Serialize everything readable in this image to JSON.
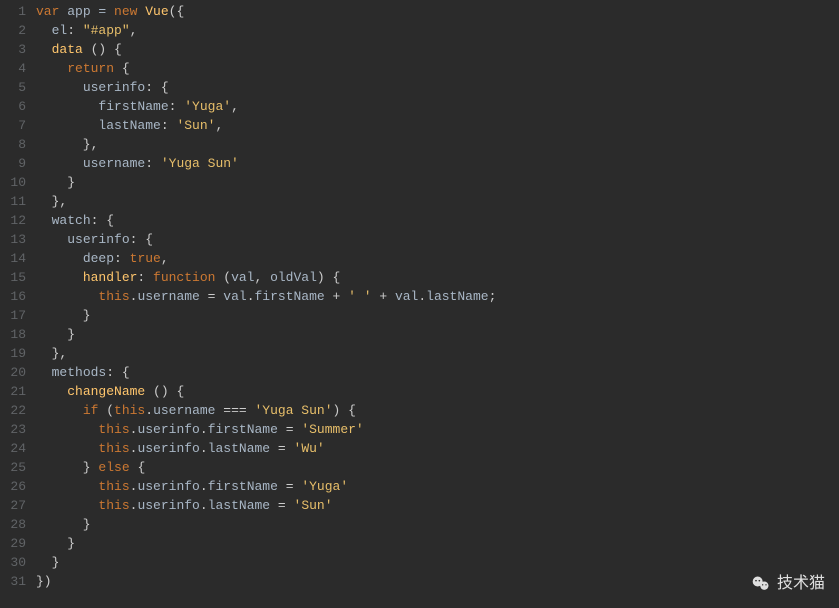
{
  "lineCount": 31,
  "watermark": "技术猫",
  "code": {
    "lines": [
      [
        {
          "t": "var ",
          "c": "kw"
        },
        {
          "t": "app = ",
          "c": "ident"
        },
        {
          "t": "new ",
          "c": "kw"
        },
        {
          "t": "Vue",
          "c": "fn"
        },
        {
          "t": "({",
          "c": "punc"
        }
      ],
      [
        {
          "t": "  ",
          "c": "plain"
        },
        {
          "t": "el",
          "c": "prop"
        },
        {
          "t": ": ",
          "c": "punc"
        },
        {
          "t": "\"#app\"",
          "c": "strq"
        },
        {
          "t": ",",
          "c": "punc"
        }
      ],
      [
        {
          "t": "  ",
          "c": "plain"
        },
        {
          "t": "data ",
          "c": "fn"
        },
        {
          "t": "() {",
          "c": "punc"
        }
      ],
      [
        {
          "t": "    ",
          "c": "plain"
        },
        {
          "t": "return ",
          "c": "kw"
        },
        {
          "t": "{",
          "c": "punc"
        }
      ],
      [
        {
          "t": "      ",
          "c": "plain"
        },
        {
          "t": "userinfo",
          "c": "prop"
        },
        {
          "t": ": {",
          "c": "punc"
        }
      ],
      [
        {
          "t": "        ",
          "c": "plain"
        },
        {
          "t": "firstName",
          "c": "prop"
        },
        {
          "t": ": ",
          "c": "punc"
        },
        {
          "t": "'Yuga'",
          "c": "strq"
        },
        {
          "t": ",",
          "c": "punc"
        }
      ],
      [
        {
          "t": "        ",
          "c": "plain"
        },
        {
          "t": "lastName",
          "c": "prop"
        },
        {
          "t": ": ",
          "c": "punc"
        },
        {
          "t": "'Sun'",
          "c": "strq"
        },
        {
          "t": ",",
          "c": "punc"
        }
      ],
      [
        {
          "t": "      },",
          "c": "punc"
        }
      ],
      [
        {
          "t": "      ",
          "c": "plain"
        },
        {
          "t": "username",
          "c": "prop"
        },
        {
          "t": ": ",
          "c": "punc"
        },
        {
          "t": "'Yuga Sun'",
          "c": "strq"
        }
      ],
      [
        {
          "t": "    }",
          "c": "punc"
        }
      ],
      [
        {
          "t": "  },",
          "c": "punc"
        }
      ],
      [
        {
          "t": "  ",
          "c": "plain"
        },
        {
          "t": "watch",
          "c": "prop"
        },
        {
          "t": ": {",
          "c": "punc"
        }
      ],
      [
        {
          "t": "    ",
          "c": "plain"
        },
        {
          "t": "userinfo",
          "c": "prop"
        },
        {
          "t": ": {",
          "c": "punc"
        }
      ],
      [
        {
          "t": "      ",
          "c": "plain"
        },
        {
          "t": "deep",
          "c": "prop"
        },
        {
          "t": ": ",
          "c": "punc"
        },
        {
          "t": "true",
          "c": "bool"
        },
        {
          "t": ",",
          "c": "punc"
        }
      ],
      [
        {
          "t": "      ",
          "c": "plain"
        },
        {
          "t": "handler",
          "c": "fn"
        },
        {
          "t": ": ",
          "c": "punc"
        },
        {
          "t": "function ",
          "c": "kw"
        },
        {
          "t": "(",
          "c": "punc"
        },
        {
          "t": "val",
          "c": "ident"
        },
        {
          "t": ", ",
          "c": "punc"
        },
        {
          "t": "oldVal",
          "c": "ident"
        },
        {
          "t": ") {",
          "c": "punc"
        }
      ],
      [
        {
          "t": "        ",
          "c": "plain"
        },
        {
          "t": "this",
          "c": "this"
        },
        {
          "t": ".",
          "c": "punc"
        },
        {
          "t": "username",
          "c": "prop"
        },
        {
          "t": " = ",
          "c": "punc"
        },
        {
          "t": "val",
          "c": "ident"
        },
        {
          "t": ".",
          "c": "punc"
        },
        {
          "t": "firstName",
          "c": "prop"
        },
        {
          "t": " + ",
          "c": "punc"
        },
        {
          "t": "' '",
          "c": "strq"
        },
        {
          "t": " + ",
          "c": "punc"
        },
        {
          "t": "val",
          "c": "ident"
        },
        {
          "t": ".",
          "c": "punc"
        },
        {
          "t": "lastName",
          "c": "prop"
        },
        {
          "t": ";",
          "c": "punc"
        }
      ],
      [
        {
          "t": "      }",
          "c": "punc"
        }
      ],
      [
        {
          "t": "    }",
          "c": "punc"
        }
      ],
      [
        {
          "t": "  },",
          "c": "punc"
        }
      ],
      [
        {
          "t": "  ",
          "c": "plain"
        },
        {
          "t": "methods",
          "c": "prop"
        },
        {
          "t": ": {",
          "c": "punc"
        }
      ],
      [
        {
          "t": "    ",
          "c": "plain"
        },
        {
          "t": "changeName ",
          "c": "fn"
        },
        {
          "t": "() {",
          "c": "punc"
        }
      ],
      [
        {
          "t": "      ",
          "c": "plain"
        },
        {
          "t": "if ",
          "c": "kw"
        },
        {
          "t": "(",
          "c": "punc"
        },
        {
          "t": "this",
          "c": "this"
        },
        {
          "t": ".",
          "c": "punc"
        },
        {
          "t": "username",
          "c": "prop"
        },
        {
          "t": " === ",
          "c": "punc"
        },
        {
          "t": "'Yuga Sun'",
          "c": "strq"
        },
        {
          "t": ") {",
          "c": "punc"
        }
      ],
      [
        {
          "t": "        ",
          "c": "plain"
        },
        {
          "t": "this",
          "c": "this"
        },
        {
          "t": ".",
          "c": "punc"
        },
        {
          "t": "userinfo",
          "c": "prop"
        },
        {
          "t": ".",
          "c": "punc"
        },
        {
          "t": "firstName",
          "c": "prop"
        },
        {
          "t": " = ",
          "c": "punc"
        },
        {
          "t": "'Summer'",
          "c": "strq"
        }
      ],
      [
        {
          "t": "        ",
          "c": "plain"
        },
        {
          "t": "this",
          "c": "this"
        },
        {
          "t": ".",
          "c": "punc"
        },
        {
          "t": "userinfo",
          "c": "prop"
        },
        {
          "t": ".",
          "c": "punc"
        },
        {
          "t": "lastName",
          "c": "prop"
        },
        {
          "t": " = ",
          "c": "punc"
        },
        {
          "t": "'Wu'",
          "c": "strq"
        }
      ],
      [
        {
          "t": "      } ",
          "c": "punc"
        },
        {
          "t": "else ",
          "c": "kw"
        },
        {
          "t": "{",
          "c": "punc"
        }
      ],
      [
        {
          "t": "        ",
          "c": "plain"
        },
        {
          "t": "this",
          "c": "this"
        },
        {
          "t": ".",
          "c": "punc"
        },
        {
          "t": "userinfo",
          "c": "prop"
        },
        {
          "t": ".",
          "c": "punc"
        },
        {
          "t": "firstName",
          "c": "prop"
        },
        {
          "t": " = ",
          "c": "punc"
        },
        {
          "t": "'Yuga'",
          "c": "strq"
        }
      ],
      [
        {
          "t": "        ",
          "c": "plain"
        },
        {
          "t": "this",
          "c": "this"
        },
        {
          "t": ".",
          "c": "punc"
        },
        {
          "t": "userinfo",
          "c": "prop"
        },
        {
          "t": ".",
          "c": "punc"
        },
        {
          "t": "lastName",
          "c": "prop"
        },
        {
          "t": " = ",
          "c": "punc"
        },
        {
          "t": "'Sun'",
          "c": "strq"
        }
      ],
      [
        {
          "t": "      }",
          "c": "punc"
        }
      ],
      [
        {
          "t": "    }",
          "c": "punc"
        }
      ],
      [
        {
          "t": "  }",
          "c": "punc"
        }
      ],
      [
        {
          "t": "})",
          "c": "punc"
        }
      ]
    ]
  }
}
